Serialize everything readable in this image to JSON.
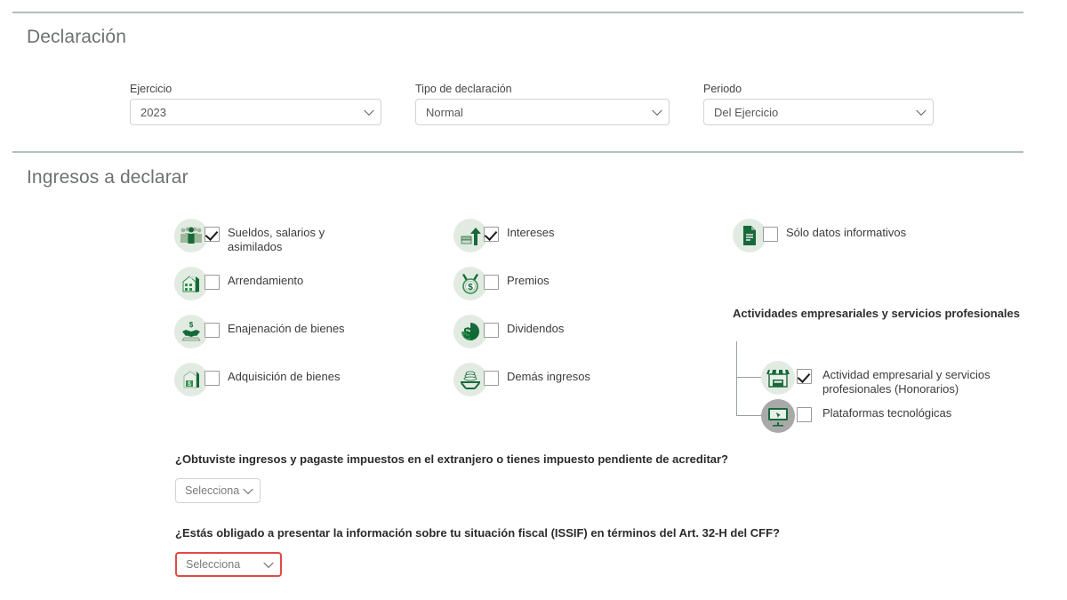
{
  "sections": {
    "declaracion": {
      "title": "Declaración"
    },
    "ingresos": {
      "title": "Ingresos a declarar"
    }
  },
  "declaracion_fields": [
    {
      "label": "Ejercicio",
      "value": "2023",
      "name": "ejercicio"
    },
    {
      "label": "Tipo de declaración",
      "value": "Normal",
      "name": "tipo-declaracion"
    },
    {
      "label": "Periodo",
      "value": "Del Ejercicio",
      "name": "periodo"
    }
  ],
  "ingresos": {
    "column1": [
      {
        "label": "Sueldos, salarios y asimilados",
        "checked": true,
        "icon": "people-group-icon"
      },
      {
        "label": "Arrendamiento",
        "checked": false,
        "icon": "building-icon"
      },
      {
        "label": "Enajenación de bienes",
        "checked": false,
        "icon": "handshake-dollar-icon"
      },
      {
        "label": "Adquisición de bienes",
        "checked": false,
        "icon": "package-dollar-icon"
      }
    ],
    "column2": [
      {
        "label": "Intereses",
        "checked": true,
        "icon": "money-up-arrow-icon"
      },
      {
        "label": "Premios",
        "checked": false,
        "icon": "medal-dollar-icon"
      },
      {
        "label": "Dividendos",
        "checked": false,
        "icon": "pie-chart-dollar-icon"
      },
      {
        "label": "Demás ingresos",
        "checked": false,
        "icon": "coins-table-icon"
      }
    ],
    "column3": [
      {
        "label": "Sólo datos informativos",
        "checked": false,
        "icon": "document-icon"
      }
    ],
    "actividades": {
      "title": "Actividades empresariales y servicios profesionales",
      "items": [
        {
          "label": "Actividad empresarial y servicios profesionales (Honorarios)",
          "checked": true,
          "icon": "storefront-icon"
        },
        {
          "label": "Plataformas tecnológicas",
          "checked": false,
          "icon": "monitor-click-icon"
        }
      ]
    }
  },
  "questions": [
    {
      "text": "¿Obtuviste ingresos y pagaste impuestos en el extranjero o tienes impuesto pendiente de acreditar?",
      "select_value": "Selecciona",
      "error": false
    },
    {
      "text": "¿Estás obligado a presentar la información sobre tu situación fiscal (ISSIF) en términos del Art. 32-H del CFF?",
      "select_value": "Selecciona",
      "error": true
    }
  ],
  "colors": {
    "heading": "#6d7271",
    "divider": "#b5bdbd",
    "icon_bg": "#e2ebe2",
    "icon_bg_gray": "#a9a9a9",
    "icon_green_dark": "#0f6b34",
    "icon_green_mid": "#2f8f4e",
    "icon_green_pale": "#9fb79a",
    "error_border": "#e04a45",
    "field_border": "#ced4da"
  }
}
